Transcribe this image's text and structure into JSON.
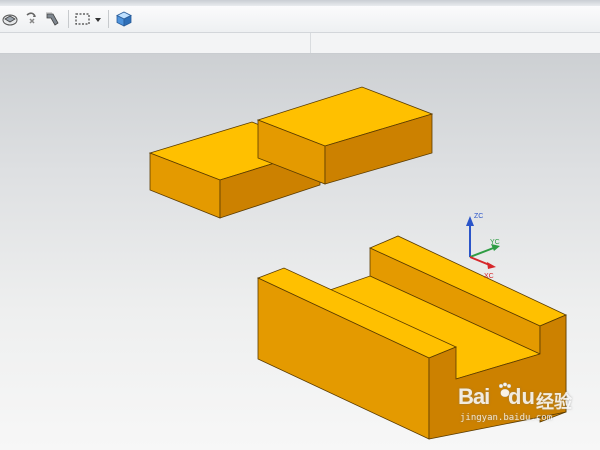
{
  "toolbar": {
    "icons": [
      {
        "id": "view-orient",
        "icon": "view-orientation-icon"
      },
      {
        "id": "rotate",
        "icon": "rotate-snap-icon"
      },
      {
        "id": "move",
        "icon": "move-face-icon"
      },
      {
        "id": "select-box",
        "icon": "select-box-icon"
      },
      {
        "id": "dropdown",
        "icon": "chevron-down-icon"
      },
      {
        "id": "shaded",
        "icon": "shaded-cube-icon"
      }
    ]
  },
  "colors": {
    "part_top": "#FFC000",
    "part_front": "#E49A00",
    "part_side": "#CC8100",
    "edge": "#5a3b00",
    "zc": "#2b55c9",
    "yc": "#2e9d44",
    "xc": "#d6272b"
  },
  "triad": {
    "zc_label": "ZC",
    "yc_label": "YC",
    "xc_label": "XC"
  },
  "watermark": {
    "bai": "Bai",
    "du": "du",
    "jingyan": "经验",
    "url": "jingyan.baidu.com"
  }
}
